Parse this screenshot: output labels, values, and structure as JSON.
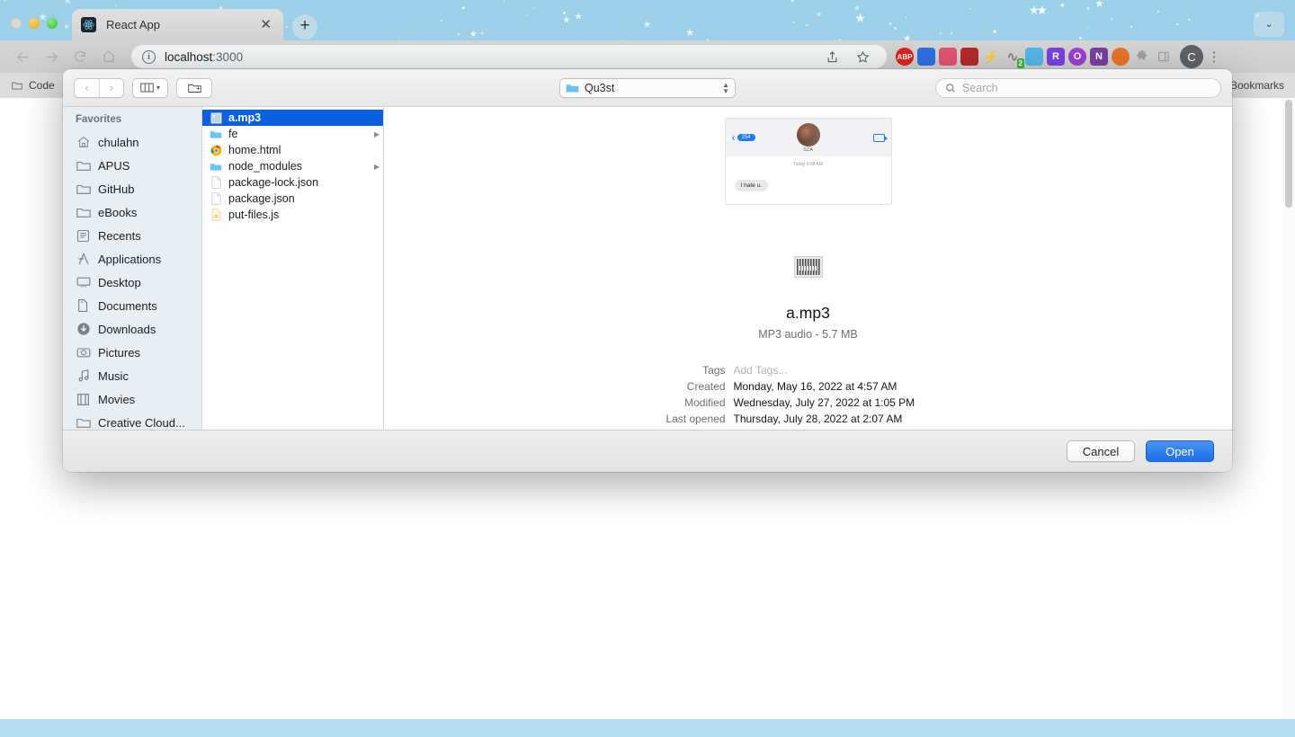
{
  "browser": {
    "tab": {
      "title": "React App",
      "favicon_icon": "react-logo-icon",
      "close_icon": "close-icon"
    },
    "new_tab_icon": "plus-icon",
    "tab_list_icon": "chevron-down-icon",
    "nav": {
      "back_icon": "back-arrow-icon",
      "forward_icon": "forward-arrow-icon",
      "reload_icon": "reload-icon",
      "home_icon": "home-icon"
    },
    "omnibox": {
      "info_icon": "info-circle-icon",
      "url_host": "localhost",
      "url_port": ":3000",
      "share_icon": "share-icon",
      "bookmark_icon": "star-icon"
    },
    "extensions": [
      {
        "name": "adblock-plus-icon",
        "label": "ABP",
        "color": "#e02020"
      },
      {
        "name": "camera-extension-icon",
        "label": "",
        "color": "#2f6fe0"
      },
      {
        "name": "pink-extension-icon",
        "label": "",
        "color": "#e0566f"
      },
      {
        "name": "shield-extension-icon",
        "label": "",
        "color": "#b42a2a"
      },
      {
        "name": "lightning-extension-icon",
        "label": "",
        "color": "#f2c10f"
      },
      {
        "name": "pulse-extension-icon",
        "label": "",
        "color": "#7b8a93",
        "badge": "2"
      },
      {
        "name": "image-extension-icon",
        "label": "",
        "color": "#56b6e8"
      },
      {
        "name": "grammarly-extension-icon",
        "label": "R",
        "color": "#7b3fe4"
      },
      {
        "name": "circle-extension-icon",
        "label": "",
        "color": "#9b3fd4"
      },
      {
        "name": "onenote-extension-icon",
        "label": "N",
        "color": "#7a3fa0"
      },
      {
        "name": "firefox-extension-icon",
        "label": "",
        "color": "#e8732a"
      },
      {
        "name": "puzzle-extensions-icon",
        "label": "",
        "color": "#9aa0a6"
      },
      {
        "name": "sidepanel-icon",
        "label": "",
        "color": "#9aa0a6"
      }
    ],
    "profile_initial": "C",
    "menu_icon": "kebab-menu-icon",
    "bookmarks": {
      "items": [
        {
          "label": "Code",
          "icon": "folder-icon"
        }
      ],
      "right_label": "Bookmarks"
    }
  },
  "dialog": {
    "toolbar": {
      "back_icon": "chevron-left-icon",
      "forward_icon": "chevron-right-icon",
      "view_icon": "column-view-icon",
      "view_chevron_icon": "chevron-down-icon",
      "new_folder_icon": "new-folder-icon",
      "path_label": "Qu3st",
      "path_icon": "folder-icon",
      "stepper_icon": "stepper-updown-icon",
      "search_icon": "search-icon",
      "search_placeholder": "Search",
      "search_value": ""
    },
    "sidebar": {
      "header": "Favorites",
      "items": [
        {
          "label": "chulahn",
          "icon": "home-icon"
        },
        {
          "label": "APUS",
          "icon": "folder-icon"
        },
        {
          "label": "GitHub",
          "icon": "folder-icon"
        },
        {
          "label": "eBooks",
          "icon": "folder-icon"
        },
        {
          "label": "Recents",
          "icon": "recents-icon"
        },
        {
          "label": "Applications",
          "icon": "applications-icon"
        },
        {
          "label": "Desktop",
          "icon": "desktop-icon"
        },
        {
          "label": "Documents",
          "icon": "documents-icon"
        },
        {
          "label": "Downloads",
          "icon": "downloads-icon"
        },
        {
          "label": "Pictures",
          "icon": "pictures-icon"
        },
        {
          "label": "Music",
          "icon": "music-icon"
        },
        {
          "label": "Movies",
          "icon": "movies-icon"
        },
        {
          "label": "Creative Cloud...",
          "icon": "folder-icon"
        }
      ]
    },
    "files": [
      {
        "name": "a.mp3",
        "icon": "image-thumb-icon",
        "selected": true,
        "expandable": false
      },
      {
        "name": "fe",
        "icon": "folder-icon",
        "selected": false,
        "expandable": true
      },
      {
        "name": "home.html",
        "icon": "chrome-icon",
        "selected": false,
        "expandable": false
      },
      {
        "name": "node_modules",
        "icon": "folder-icon",
        "selected": false,
        "expandable": true
      },
      {
        "name": "package-lock.json",
        "icon": "blank-doc-icon",
        "selected": false,
        "expandable": false
      },
      {
        "name": "package.json",
        "icon": "blank-doc-icon",
        "selected": false,
        "expandable": false
      },
      {
        "name": "put-files.js",
        "icon": "js-doc-icon",
        "selected": false,
        "expandable": false
      }
    ],
    "preview": {
      "thumbnail": {
        "contact_name": "SZA",
        "back_pill": "254",
        "timestamp": "Today 9:08 AM",
        "message": "I hate u.",
        "back_icon": "chevron-left-icon",
        "video_icon": "video-camera-icon",
        "avatar_icon": "contact-avatar"
      },
      "file_icon": "audio-file-icon",
      "file_name": "a.mp3",
      "kind_and_size": "MP3 audio - 5.7 MB",
      "metadata": [
        {
          "key": "Tags",
          "value": "Add Tags...",
          "placeholder": true
        },
        {
          "key": "Created",
          "value": "Monday, May 16, 2022 at 4:57 AM",
          "placeholder": false
        },
        {
          "key": "Modified",
          "value": "Wednesday, July 27, 2022 at 1:05 PM",
          "placeholder": false
        },
        {
          "key": "Last opened",
          "value": "Thursday, July 28, 2022 at 2:07 AM",
          "placeholder": false
        }
      ]
    },
    "footer": {
      "cancel_label": "Cancel",
      "open_label": "Open"
    }
  },
  "colors": {
    "selection_blue": "#0a60dd",
    "primary_button": "#1a6fe8",
    "sidebar_bg": "#e8eef2"
  }
}
